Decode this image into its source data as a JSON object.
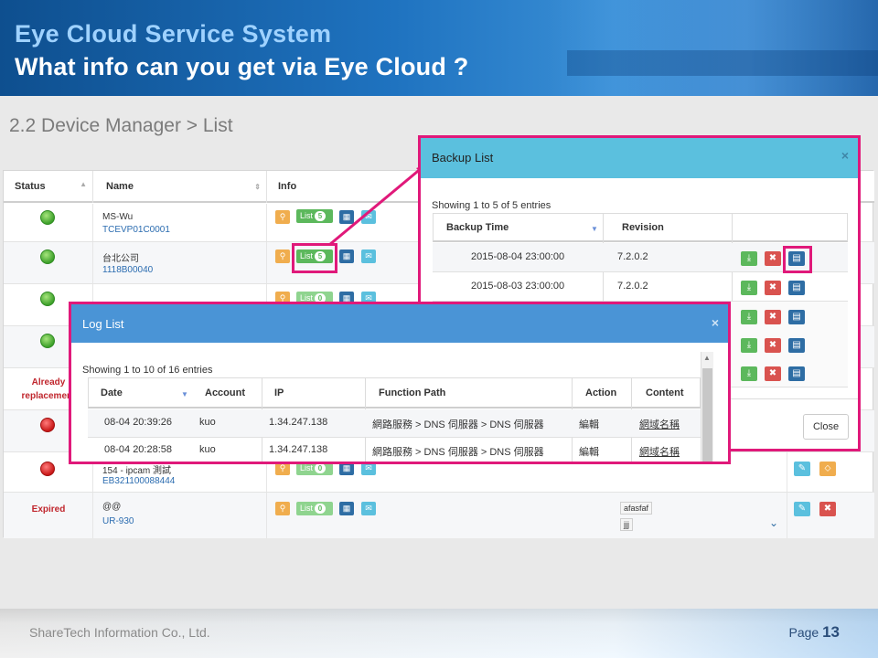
{
  "header": {
    "title": "Eye Cloud Service System",
    "question": "What info can you get via Eye Cloud ?"
  },
  "subtitle": "2.2 Device Manager > List",
  "device_table": {
    "columns": [
      "Status",
      "Name",
      "Info"
    ],
    "rows": [
      {
        "status": "online",
        "name": "MS-Wu",
        "id": "TCEVP01C0001",
        "list_count": "5"
      },
      {
        "status": "online",
        "name": "台北公司",
        "id": "1118B00040",
        "list_count": "5"
      },
      {
        "status": "online",
        "name": "",
        "id": "",
        "list_count": "0"
      },
      {
        "status": "online",
        "name": "",
        "id": "",
        "list_count": ""
      },
      {
        "status_text": "Already replacement",
        "name": "",
        "id": ""
      },
      {
        "status": "offline",
        "name": "",
        "id": ""
      },
      {
        "status": "offline",
        "name": "154 - ipcam 測試",
        "id": "EB321100088444",
        "list_count": "0"
      },
      {
        "status_text": "Expired",
        "name": "@@",
        "id": "UR-930",
        "list_count": "0",
        "tags": [
          "afasfaf",
          "jjj"
        ]
      }
    ],
    "list_label": "List"
  },
  "backup_modal": {
    "title": "Backup List",
    "close": "×",
    "info": "Showing 1 to 5 of 5 entries",
    "columns": [
      "Backup Time",
      "Revision"
    ],
    "rows": [
      {
        "time": "2015-08-04 23:00:00",
        "revision": "7.2.0.2"
      },
      {
        "time": "2015-08-03 23:00:00",
        "revision": "7.2.0.2"
      }
    ],
    "close_button": "Close"
  },
  "log_modal": {
    "title": "Log List",
    "close": "×",
    "info": "Showing 1 to 10 of 16 entries",
    "columns": [
      "Date",
      "Account",
      "IP",
      "Function Path",
      "Action",
      "Content"
    ],
    "rows": [
      {
        "date": "08-04 20:39:26",
        "account": "kuo",
        "ip": "1.34.247.138",
        "path": "網路服務 > DNS 伺服器 > DNS 伺服器",
        "action": "編輯",
        "content": "網域名稱"
      },
      {
        "date": "08-04 20:28:58",
        "account": "kuo",
        "ip": "1.34.247.138",
        "path": "網路服務 > DNS 伺服器 > DNS 伺服器",
        "action": "編輯",
        "content": "網域名稱"
      }
    ]
  },
  "footer": {
    "company": "ShareTech Information Co., Ltd.",
    "page_label": "Page",
    "page_number": "13"
  },
  "colors": {
    "highlight": "#e0197a",
    "modal_header": "#5bc0de",
    "header_blue": "#1f73c0"
  }
}
